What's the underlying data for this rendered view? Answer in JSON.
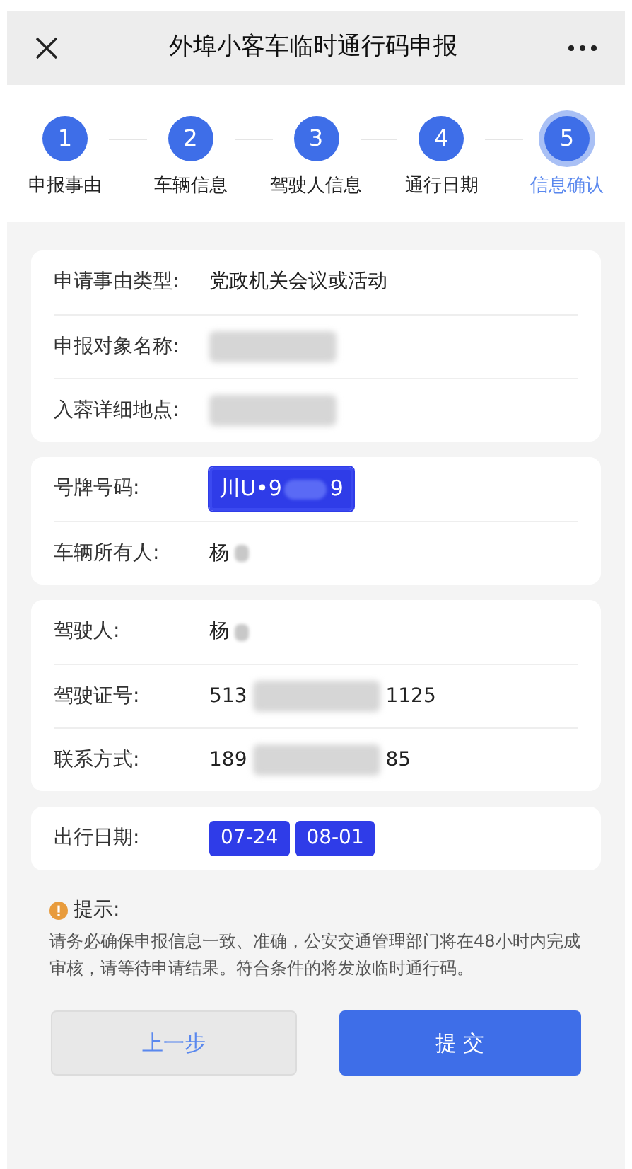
{
  "header": {
    "title": "外埠小客车临时通行码申报"
  },
  "steps": [
    {
      "number": "1",
      "label": "申报事由",
      "selected": false
    },
    {
      "number": "2",
      "label": "车辆信息",
      "selected": false
    },
    {
      "number": "3",
      "label": "驾驶人信息",
      "selected": false
    },
    {
      "number": "4",
      "label": "通行日期",
      "selected": false
    },
    {
      "number": "5",
      "label": "信息确认",
      "selected": true
    }
  ],
  "cards": [
    {
      "rows": [
        {
          "label": "申请事由类型:",
          "parts": [
            {
              "kind": "text",
              "text": "党政机关会议或活动"
            }
          ]
        },
        {
          "label": "申报对象名称:",
          "parts": [
            {
              "kind": "blur"
            }
          ]
        },
        {
          "label": "入蓉详细地点:",
          "parts": [
            {
              "kind": "blur"
            }
          ]
        }
      ]
    },
    {
      "rows": [
        {
          "label": "号牌号码:",
          "parts": [
            {
              "kind": "plate",
              "text": "川U•9",
              "tail": "9"
            }
          ]
        },
        {
          "label": "车辆所有人:",
          "parts": [
            {
              "kind": "text",
              "text": "杨"
            },
            {
              "kind": "dot"
            }
          ]
        }
      ]
    },
    {
      "rows": [
        {
          "label": "驾驶人:",
          "parts": [
            {
              "kind": "text",
              "text": "杨"
            },
            {
              "kind": "dot"
            }
          ]
        },
        {
          "label": "驾驶证号:",
          "parts": [
            {
              "kind": "text",
              "text": "513"
            },
            {
              "kind": "blur"
            },
            {
              "kind": "text",
              "text": "1125"
            }
          ]
        },
        {
          "label": "联系方式:",
          "parts": [
            {
              "kind": "text",
              "text": "189"
            },
            {
              "kind": "blur"
            },
            {
              "kind": "text",
              "text": "85"
            }
          ]
        }
      ]
    },
    {
      "rows": [
        {
          "label": "出行日期:",
          "parts": [
            {
              "kind": "tag",
              "text": "07-24"
            },
            {
              "kind": "tag",
              "text": "08-01"
            }
          ]
        }
      ]
    }
  ],
  "notice": {
    "title": "提示:",
    "text": "请务必确保申报信息一致、准确，公安交通管理部门将在48小时内完成审核，请等待申请结果。符合条件的将发放临时通行码。"
  },
  "buttons": [
    {
      "label": "上一步",
      "kind": "secondary"
    },
    {
      "label": "提 交",
      "kind": "primary"
    }
  ]
}
